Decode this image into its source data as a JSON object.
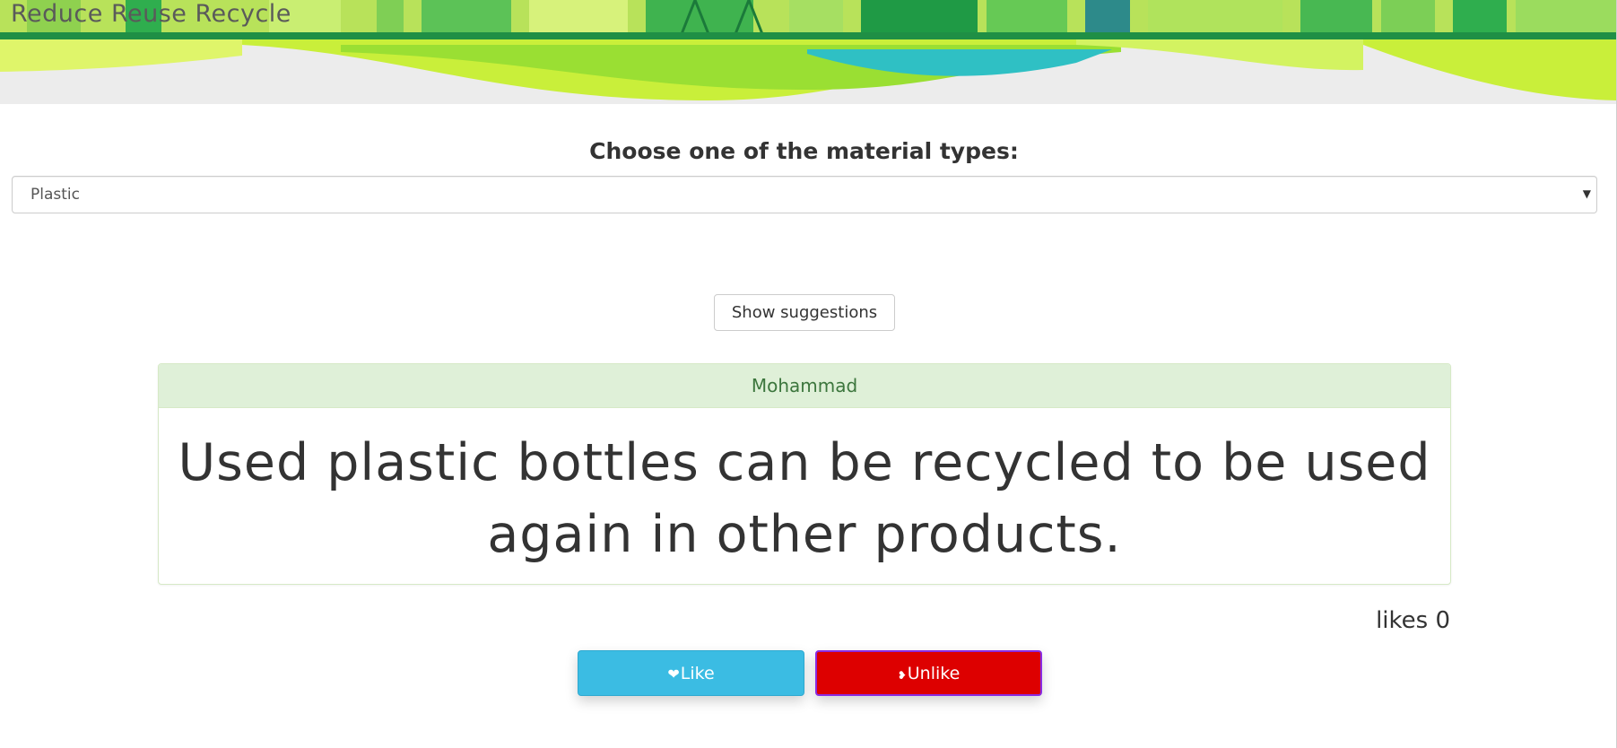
{
  "app": {
    "brand": "Reduce Reuse Recycle"
  },
  "form": {
    "label": "Choose one of the material types:",
    "selected": "Plastic",
    "show_button": "Show suggestions"
  },
  "suggestion": {
    "author": "Mohammad",
    "text": "Used plastic bottles can be recycled to be used again in other products.",
    "likes_text": "likes 0",
    "likes": 0
  },
  "actions": {
    "like_label": "Like",
    "unlike_label": "Unlike",
    "like_icon": "heart-icon",
    "unlike_icon": "broken-heart-icon"
  },
  "colors": {
    "like": "#3bbce3",
    "unlike": "#dd0000",
    "card_header": "#dff0d8",
    "card_header_text": "#3c763d"
  }
}
